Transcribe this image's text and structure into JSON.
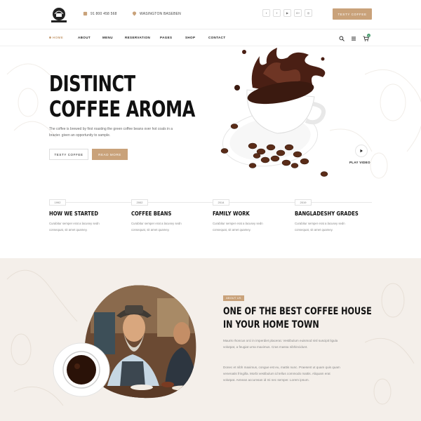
{
  "header": {
    "phone": "91 800 458 568",
    "address": "WASINGTON BASEBEN",
    "socials": [
      {
        "icon": "twitter-icon",
        "glyph": "t"
      },
      {
        "icon": "facebook-icon",
        "glyph": "f"
      },
      {
        "icon": "youtube-icon",
        "glyph": "▶"
      },
      {
        "icon": "google-plus-icon",
        "glyph": "G+"
      },
      {
        "icon": "instagram-icon",
        "glyph": "◎"
      }
    ],
    "cta_label": "TESTY COFFEE",
    "cart_count": "0"
  },
  "nav": {
    "items": [
      {
        "label": "HOME",
        "active": true
      },
      {
        "label": "ABOUT"
      },
      {
        "label": "MENU"
      },
      {
        "label": "RESERVATION"
      },
      {
        "label": "PAGES"
      },
      {
        "label": "SHOP"
      },
      {
        "label": "CONTACT"
      }
    ]
  },
  "hero": {
    "title_line1": "DISTINCT",
    "title_line2": "COFFEE AROMA",
    "text": "The coffee is brewed by first roasting the green coffee beans over hot coals in a brazier. given an opportunity to sample.",
    "button1": "TESTY COFFEE",
    "button2": "READ MORE",
    "play_label": "PLAY VIDEO"
  },
  "timeline": [
    {
      "year": "1992",
      "title": "HOW WE STARTED",
      "text": "Curabitur semper erat a lacusey sedn consequat, sit amet quamey."
    },
    {
      "year": "2002",
      "title": "COFFEE BEANS",
      "text": "Curabitur semper erat a lacusey sedn consequat, sit amet quamey."
    },
    {
      "year": "2014",
      "title": "FAMILY WORK",
      "text": "Curabitur semper erat a lacusey sedn consequat, sit amet quamey."
    },
    {
      "year": "2019",
      "title": "BANGLADESHY GRADES",
      "text": "Curabitur semper erat a lacusey sedn consequat, sit amet quamey."
    }
  ],
  "about": {
    "badge": "ABOUT US",
    "title_line1": "ONE OF THE BEST COFFEE HOUSE",
    "title_line2": "IN YOUR HOME TOWN",
    "para1": "Mauris rhoncus orci in imperdiet placerat. Vestibulum euismod nisl suscipit ligula volutpat, a feugiat urna maximus. Cras massa nibhincidunt.",
    "para2": "Donec et nibh maximus, congue est eu, mattis nunc. Praesent ut quam quis quam venenatis fringilla. Morbi vestibulum id tellus commodo mattis. Aliquam erat volutpat. Aenean accumsan id mi nec semper. Lorem ipsum."
  },
  "colors": {
    "accent": "#c9a27a",
    "about_bg": "#f4efea"
  }
}
